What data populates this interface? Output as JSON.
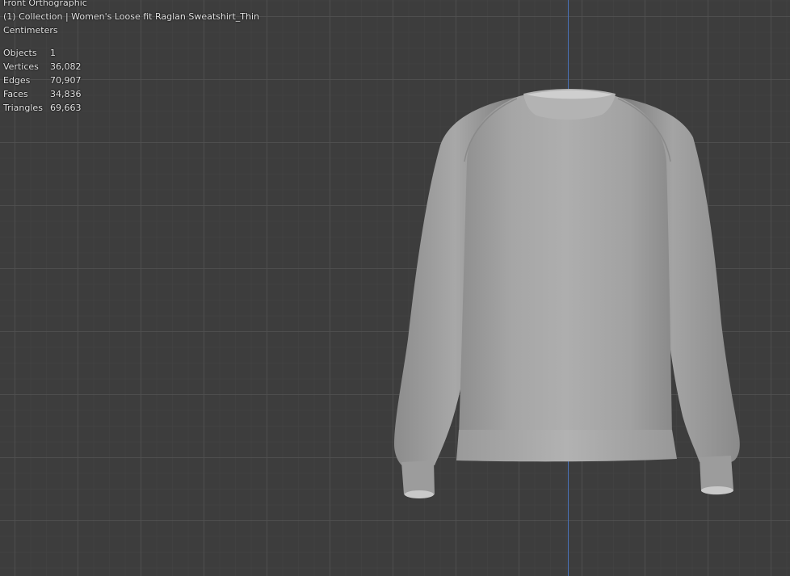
{
  "viewport": {
    "view_name": "Front Orthographic",
    "collection_info": "(1) Collection | Women's Loose fit Raglan Sweatshirt_Thin",
    "units": "Centimeters",
    "stats": [
      {
        "label": "Objects",
        "value": "1"
      },
      {
        "label": "Vertices",
        "value": "36,082"
      },
      {
        "label": "Edges",
        "value": "70,907"
      },
      {
        "label": "Faces",
        "value": "34,836"
      },
      {
        "label": "Triangles",
        "value": "69,663"
      }
    ],
    "colors": {
      "background": "#3d3d3d",
      "grid": "#505050",
      "z_axis": "#4a72b8",
      "mesh": "#a9a9a9"
    }
  }
}
